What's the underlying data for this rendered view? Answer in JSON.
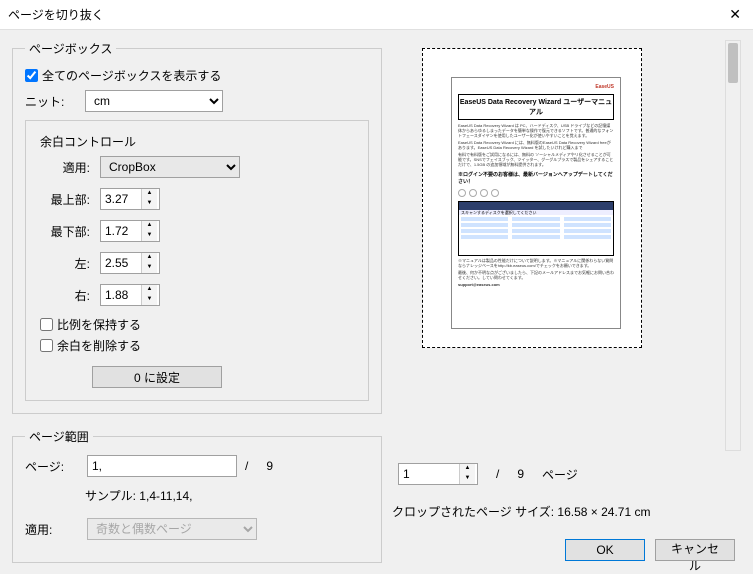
{
  "window": {
    "title": "ページを切り抜く"
  },
  "pageBox": {
    "legend": "ぺージボックス",
    "showAll_label": "全てのページボックスを表示する",
    "unit_label": "ニット:",
    "unit_value": "cm",
    "margin": {
      "legend": "余白コントロール",
      "apply_label": "適用:",
      "apply_value": "CropBox",
      "top_label": "最上部:",
      "top_value": "3.27",
      "bottom_label": "最下部:",
      "bottom_value": "1.72",
      "left_label": "左:",
      "left_value": "2.55",
      "right_label": "右:",
      "right_value": "1.88",
      "keepRatio_label": "比例を保持する",
      "removeMargin_label": "余白を削除する",
      "btn_reset": "0 に設定"
    }
  },
  "pageRange": {
    "legend": "ページ範囲",
    "page_label": "ページ:",
    "page_value": "1,",
    "slash": "/",
    "total": "9",
    "sample_label": "サンプル: 1,4-11,14,",
    "apply_label": "適用:",
    "apply_value": "奇数と偶数ページ"
  },
  "preview": {
    "docTitle": "EaseUS Data Recovery Wizard ユーザーマニュアル",
    "line1": "EaseUS Data Recovery Wizard は PC、ハードディスク、USB ドライブなどの記憶媒体からあらゆるしまったデータを簡単な操作で復元できるソフトです。普通的なフォントフェースダイヤンを使用したユーザー化が使いやすいことを覚えます。",
    "line2": "EaseUS Data Recovery Wizard には、無料版のEaseUS Data Recovery Wizard freeがあります。EaseUS Data Recovery Wizard を試したいけれど購入まで",
    "line3": "有料で有料版をご試用になるには、無料の ソーシャルメディアやリ化させることが可能です。SNSでフェイスブック、ツイッター、グーグルプラスで製品をシェアすることだけで、1.5GB の追加領域が無料提供されます。",
    "bold1": "※ログイン不要のお客様は、最新バージョンへアップデートしてください！",
    "line4": "※マニュアルは製品の性能だけについて説明します。※マニュアルに関係わらない質問ならナレッジベースをhttp://kb.easeus.com/でチェックをお願いできます。",
    "line5": "最後、何か不明な点がございましたら、下記のメールアドレスまでお気軽にお問い合わせください。してい問わせてくます。",
    "email": "support@easeus.com",
    "dsSub": "スキャンするディスクを選択してください"
  },
  "pager": {
    "current": "1",
    "slash": "/",
    "total": "9",
    "label": "ページ"
  },
  "cropSize": {
    "label": "クロップされたページ サイズ:",
    "value": "16.58 × 24.71 cm"
  },
  "footer": {
    "ok": "OK",
    "cancel": "キャンセル"
  }
}
